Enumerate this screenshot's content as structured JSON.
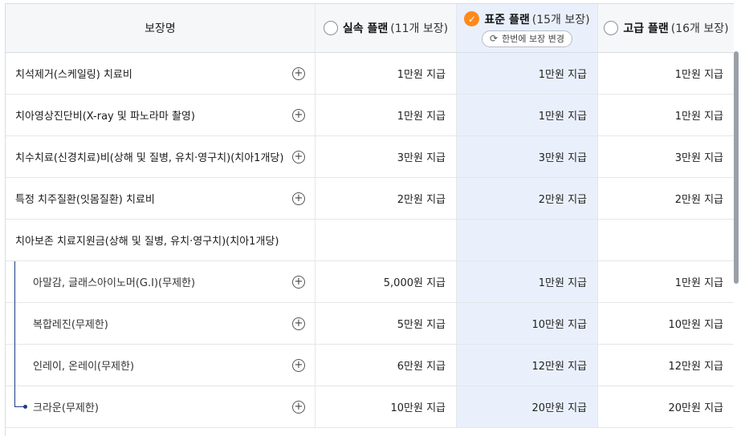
{
  "header": {
    "coverage_label": "보장명",
    "plans": [
      {
        "name": "실속 플랜",
        "count": "(11개 보장)",
        "selected": false
      },
      {
        "name": "표준 플랜",
        "count": "(15개 보장)",
        "selected": true
      },
      {
        "name": "고급 플랜",
        "count": "(16개 보장)",
        "selected": false
      }
    ],
    "change_button": "한번에 보장 변경"
  },
  "rows": [
    {
      "name": "치석제거(스케일링) 치료비",
      "sub": false,
      "values": [
        "1만원 지급",
        "1만원 지급",
        "1만원 지급"
      ]
    },
    {
      "name": "치아영상진단비(X-ray 및 파노라마 촬영)",
      "sub": false,
      "values": [
        "1만원 지급",
        "1만원 지급",
        "1만원 지급"
      ]
    },
    {
      "name": "치수치료(신경치료)비(상해 및 질병, 유치·영구치)(치아1개당)",
      "sub": false,
      "values": [
        "3만원 지급",
        "3만원 지급",
        "3만원 지급"
      ]
    },
    {
      "name": "특정 치주질환(잇몸질환) 치료비",
      "sub": false,
      "values": [
        "2만원 지급",
        "2만원 지급",
        "2만원 지급"
      ]
    },
    {
      "name": "치아보존 치료지원금(상해 및 질병, 유치·영구치)(치아1개당)",
      "sub": false,
      "values": [
        "",
        "",
        ""
      ]
    },
    {
      "name": "아말감, 글래스아이노머(G.I)(무제한)",
      "sub": true,
      "values": [
        "5,000원 지급",
        "1만원 지급",
        "1만원 지급"
      ]
    },
    {
      "name": "복합레진(무제한)",
      "sub": true,
      "values": [
        "5만원 지급",
        "10만원 지급",
        "10만원 지급"
      ]
    },
    {
      "name": "인레이, 온레이(무제한)",
      "sub": true,
      "values": [
        "6만원 지급",
        "12만원 지급",
        "12만원 지급"
      ]
    },
    {
      "name": "크라운(무제한)",
      "sub": true,
      "values": [
        "10만원 지급",
        "20만원 지급",
        "20만원 지급"
      ]
    }
  ],
  "colors": {
    "selected_bg": "#eaf0fb",
    "accent": "#ff8a1c",
    "tree": "#1f3c88"
  },
  "icons": {
    "expand": "plus-circle-icon",
    "selected": "check-circle-icon",
    "refresh": "refresh-icon"
  }
}
